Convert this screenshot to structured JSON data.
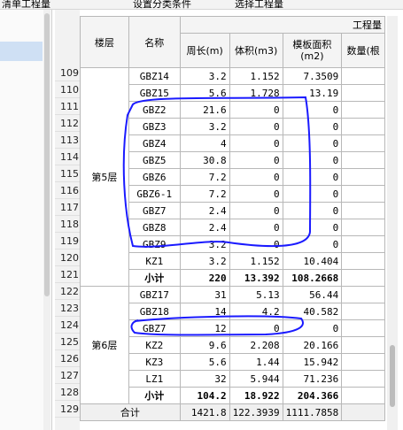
{
  "toolbar": {
    "left_dropdown": "清单工程量",
    "btn_settings": "设置分类条件",
    "btn_select": "选择工程量"
  },
  "header": {
    "floor": "楼层",
    "name": "名称",
    "group": "工程量",
    "perimeter": "周长(m)",
    "volume": "体积(m3)",
    "formwork": "模板面积(m2)",
    "quantity": "数量(根"
  },
  "rows": [
    {
      "n": "109",
      "name": "GBZ14",
      "p": "3.2",
      "v": "1.152",
      "f": "7.3509"
    },
    {
      "n": "110",
      "name": "GBZ15",
      "p": "5.6",
      "v": "1.728",
      "f": "13.19"
    },
    {
      "n": "111",
      "name": "GBZ2",
      "p": "21.6",
      "v": "0",
      "f": "0"
    },
    {
      "n": "112",
      "name": "GBZ3",
      "p": "3.2",
      "v": "0",
      "f": "0"
    },
    {
      "n": "113",
      "name": "GBZ4",
      "p": "4",
      "v": "0",
      "f": "0"
    },
    {
      "n": "114",
      "name": "GBZ5",
      "p": "30.8",
      "v": "0",
      "f": "0"
    },
    {
      "n": "115",
      "name": "GBZ6",
      "p": "7.2",
      "v": "0",
      "f": "0"
    },
    {
      "n": "116",
      "name": "GBZ6-1",
      "p": "7.2",
      "v": "0",
      "f": "0"
    },
    {
      "n": "117",
      "name": "GBZ7",
      "p": "2.4",
      "v": "0",
      "f": "0"
    },
    {
      "n": "118",
      "name": "GBZ8",
      "p": "2.4",
      "v": "0",
      "f": "0"
    },
    {
      "n": "119",
      "name": "GBZ9",
      "p": "3.2",
      "v": "0",
      "f": "0"
    },
    {
      "n": "120",
      "name": "KZ1",
      "p": "3.2",
      "v": "1.152",
      "f": "10.404"
    },
    {
      "n": "121",
      "name": "小计",
      "p": "220",
      "v": "13.392",
      "f": "108.2668",
      "bold": true
    },
    {
      "n": "122",
      "name": "GBZ17",
      "p": "31",
      "v": "5.13",
      "f": "56.44"
    },
    {
      "n": "123",
      "name": "GBZ18",
      "p": "14",
      "v": "4.2",
      "f": "40.582"
    },
    {
      "n": "124",
      "name": "GBZ7",
      "p": "12",
      "v": "0",
      "f": "0"
    },
    {
      "n": "125",
      "name": "KZ2",
      "p": "9.6",
      "v": "2.208",
      "f": "20.166"
    },
    {
      "n": "126",
      "name": "KZ3",
      "p": "5.6",
      "v": "1.44",
      "f": "15.942"
    },
    {
      "n": "127",
      "name": "LZ1",
      "p": "32",
      "v": "5.944",
      "f": "71.236"
    },
    {
      "n": "128",
      "name": "小计",
      "p": "104.2",
      "v": "18.922",
      "f": "204.366",
      "bold": true
    },
    {
      "n": "129",
      "name": "合计",
      "p": "1421.8",
      "v": "122.3939",
      "f": "1111.7858"
    }
  ],
  "floors": {
    "f5": "第5层",
    "f6": "第6层"
  },
  "annotation_color": "#1a1aff"
}
